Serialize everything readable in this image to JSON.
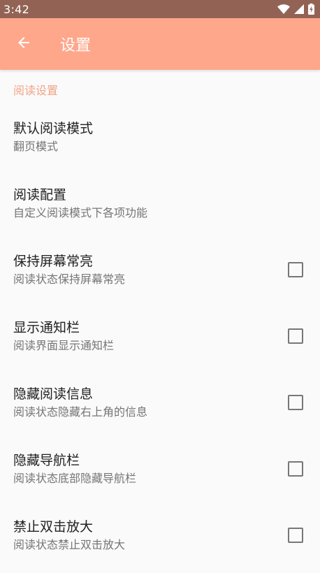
{
  "status_bar": {
    "time": "3:42"
  },
  "app_bar": {
    "title": "设置",
    "back_icon": "arrow-left-icon"
  },
  "colors": {
    "status_bar": "#926354",
    "app_bar": "#ffa78b",
    "accent": "#f2a487",
    "background": "#fafafa"
  },
  "category": {
    "title": "阅读设置"
  },
  "items": [
    {
      "title": "默认阅读模式",
      "summary": "翻页模式",
      "checkbox": false
    },
    {
      "title": "阅读配置",
      "summary": "自定义阅读模式下各项功能",
      "checkbox": false
    },
    {
      "title": "保持屏幕常亮",
      "summary": "阅读状态保持屏幕常亮",
      "checkbox": true,
      "checked": false
    },
    {
      "title": "显示通知栏",
      "summary": "阅读界面显示通知栏",
      "checkbox": true,
      "checked": false
    },
    {
      "title": "隐藏阅读信息",
      "summary": "阅读状态隐藏右上角的信息",
      "checkbox": true,
      "checked": false
    },
    {
      "title": "隐藏导航栏",
      "summary": "阅读状态底部隐藏导航栏",
      "checkbox": true,
      "checked": false
    },
    {
      "title": "禁止双击放大",
      "summary": "阅读状态禁止双击放大",
      "checkbox": true,
      "checked": false
    }
  ]
}
